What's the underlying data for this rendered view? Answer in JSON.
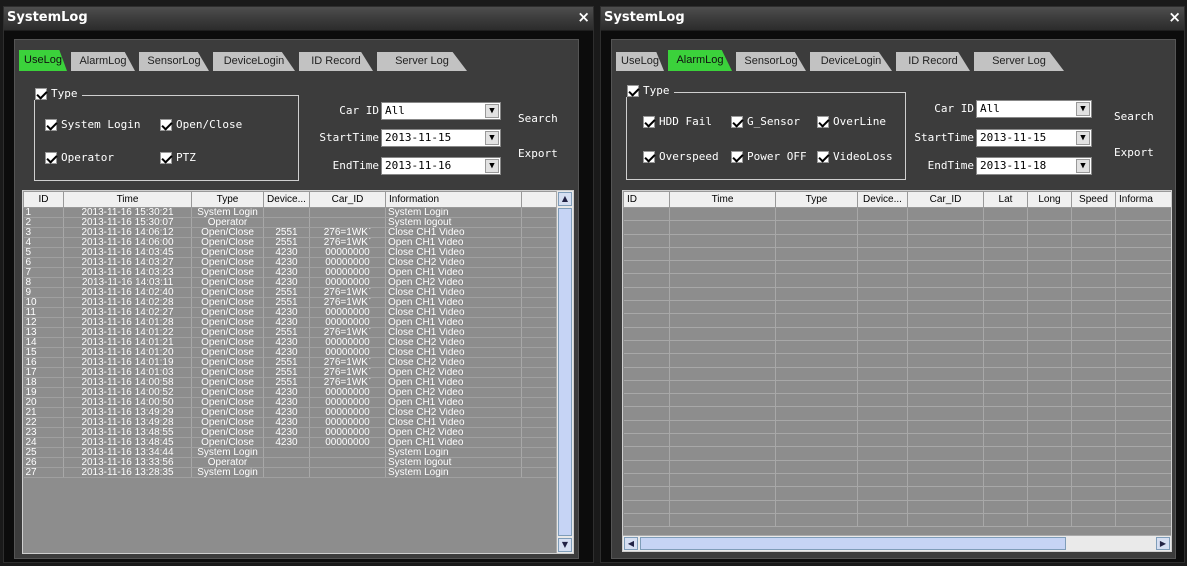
{
  "left_window": {
    "title": "SystemLog",
    "close": "×",
    "tabs": [
      "UseLog",
      "AlarmLog",
      "SensorLog",
      "DeviceLogin",
      "ID Record",
      "Server Log"
    ],
    "active_tab": "UseLog",
    "group_title": "Type",
    "options": [
      "System Login",
      "Open/Close",
      "Operator",
      "PTZ"
    ],
    "car_id_label": "Car ID",
    "car_id_value": "All",
    "start_label": "StartTime",
    "start_value": "2013-11-15",
    "end_label": "EndTime",
    "end_value": "2013-11-16",
    "search": "Search",
    "export": "Export",
    "columns": [
      "ID",
      "Time",
      "Type",
      "Device...",
      "Car_ID",
      "Information"
    ],
    "rows": [
      [
        "1",
        "2013-11-16 15:30:21",
        "System Login",
        "",
        "",
        "System Login"
      ],
      [
        "2",
        "2013-11-16 15:30:07",
        "Operator",
        "",
        "",
        "System logout"
      ],
      [
        "3",
        "2013-11-16 14:06:12",
        "Open/Close",
        "2551",
        "276=1WK`",
        "Close CH1 Video"
      ],
      [
        "4",
        "2013-11-16 14:06:00",
        "Open/Close",
        "2551",
        "276=1WK`",
        "Open CH1 Video"
      ],
      [
        "5",
        "2013-11-16 14:03:45",
        "Open/Close",
        "4230",
        "00000000",
        "Close CH1 Video"
      ],
      [
        "6",
        "2013-11-16 14:03:27",
        "Open/Close",
        "4230",
        "00000000",
        "Close CH2 Video"
      ],
      [
        "7",
        "2013-11-16 14:03:23",
        "Open/Close",
        "4230",
        "00000000",
        "Open CH1 Video"
      ],
      [
        "8",
        "2013-11-16 14:03:11",
        "Open/Close",
        "4230",
        "00000000",
        "Open CH2 Video"
      ],
      [
        "9",
        "2013-11-16 14:02:40",
        "Open/Close",
        "2551",
        "276=1WK`",
        "Close CH1 Video"
      ],
      [
        "10",
        "2013-11-16 14:02:28",
        "Open/Close",
        "2551",
        "276=1WK`",
        "Open CH1 Video"
      ],
      [
        "11",
        "2013-11-16 14:02:27",
        "Open/Close",
        "4230",
        "00000000",
        "Close CH1 Video"
      ],
      [
        "12",
        "2013-11-16 14:01:28",
        "Open/Close",
        "4230",
        "00000000",
        "Open CH1 Video"
      ],
      [
        "13",
        "2013-11-16 14:01:22",
        "Open/Close",
        "2551",
        "276=1WK`",
        "Close CH1 Video"
      ],
      [
        "14",
        "2013-11-16 14:01:21",
        "Open/Close",
        "4230",
        "00000000",
        "Close CH2 Video"
      ],
      [
        "15",
        "2013-11-16 14:01:20",
        "Open/Close",
        "4230",
        "00000000",
        "Close CH1 Video"
      ],
      [
        "16",
        "2013-11-16 14:01:19",
        "Open/Close",
        "2551",
        "276=1WK`",
        "Close CH2 Video"
      ],
      [
        "17",
        "2013-11-16 14:01:03",
        "Open/Close",
        "2551",
        "276=1WK`",
        "Open CH2 Video"
      ],
      [
        "18",
        "2013-11-16 14:00:58",
        "Open/Close",
        "2551",
        "276=1WK`",
        "Open CH1 Video"
      ],
      [
        "19",
        "2013-11-16 14:00:52",
        "Open/Close",
        "4230",
        "00000000",
        "Open CH2 Video"
      ],
      [
        "20",
        "2013-11-16 14:00:50",
        "Open/Close",
        "4230",
        "00000000",
        "Open CH1 Video"
      ],
      [
        "21",
        "2013-11-16 13:49:29",
        "Open/Close",
        "4230",
        "00000000",
        "Close CH2 Video"
      ],
      [
        "22",
        "2013-11-16 13:49:28",
        "Open/Close",
        "4230",
        "00000000",
        "Close CH1 Video"
      ],
      [
        "23",
        "2013-11-16 13:48:55",
        "Open/Close",
        "4230",
        "00000000",
        "Open CH2 Video"
      ],
      [
        "24",
        "2013-11-16 13:48:45",
        "Open/Close",
        "4230",
        "00000000",
        "Open CH1 Video"
      ],
      [
        "25",
        "2013-11-16 13:34:44",
        "System Login",
        "",
        "",
        "System Login"
      ],
      [
        "26",
        "2013-11-16 13:33:56",
        "Operator",
        "",
        "",
        "System logout"
      ],
      [
        "27",
        "2013-11-16 13:28:35",
        "System Login",
        "",
        "",
        "System Login"
      ]
    ]
  },
  "right_window": {
    "title": "SystemLog",
    "close": "×",
    "tabs": [
      "UseLog",
      "AlarmLog",
      "SensorLog",
      "DeviceLogin",
      "ID Record",
      "Server Log"
    ],
    "active_tab": "AlarmLog",
    "group_title": "Type",
    "options": [
      "HDD Fail",
      "G_Sensor",
      "OverLine",
      "Overspeed",
      "Power OFF",
      "VideoLoss"
    ],
    "car_id_label": "Car ID",
    "car_id_value": "All",
    "start_label": "StartTime",
    "start_value": "2013-11-15",
    "end_label": "EndTime",
    "end_value": "2013-11-18",
    "search": "Search",
    "export": "Export",
    "columns": [
      "ID",
      "Time",
      "Type",
      "Device...",
      "Car_ID",
      "Lat",
      "Long",
      "Speed",
      "Informa"
    ],
    "empty_rows": 24
  },
  "icons": {
    "checkbox": "checked-checkbox-icon",
    "dropdown": "chevron-down-icon",
    "scroll_up": "scroll-up-icon",
    "scroll_down": "scroll-down-icon",
    "scroll_left": "scroll-left-icon",
    "scroll_right": "scroll-right-icon"
  },
  "colors": {
    "active_tab": "#3bd23b",
    "panel": "#3c3c3c",
    "grid": "#8d8d8d"
  }
}
